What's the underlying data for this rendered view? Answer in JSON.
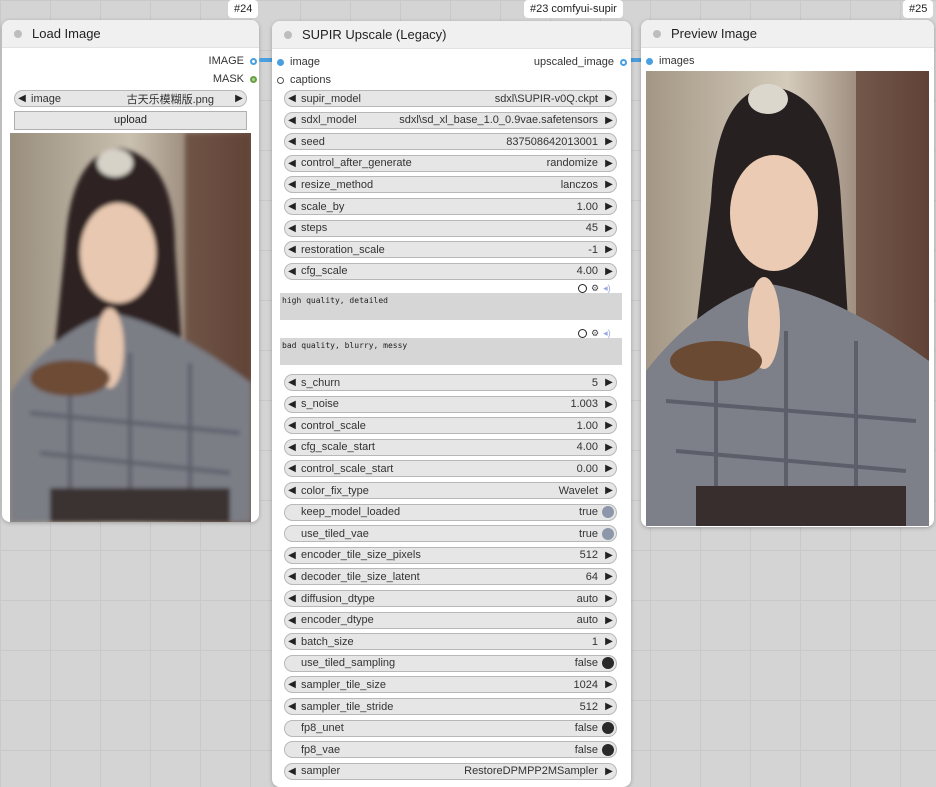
{
  "load_image": {
    "title": "Load Image",
    "badge": "#24",
    "outputs": [
      "IMAGE",
      "MASK"
    ],
    "image_widget_label": "image",
    "image_widget_value": "古天乐模糊版.png",
    "upload_label": "upload"
  },
  "supir": {
    "title": "SUPIR Upscale (Legacy)",
    "badge": "#23 comfyui-supir",
    "inputs": [
      "image",
      "captions"
    ],
    "output": "upscaled_image",
    "positive_prompt": "high quality, detailed",
    "negative_prompt": "bad quality, blurry, messy",
    "widgets": [
      {
        "label": "supir_model",
        "value": "sdxl\\SUPIR-v0Q.ckpt",
        "kind": "combo"
      },
      {
        "label": "sdxl_model",
        "value": "sdxl\\sd_xl_base_1.0_0.9vae.safetensors",
        "kind": "combo"
      },
      {
        "label": "seed",
        "value": "837508642013001",
        "kind": "combo"
      },
      {
        "label": "control_after_generate",
        "value": "randomize",
        "kind": "combo"
      },
      {
        "label": "resize_method",
        "value": "lanczos",
        "kind": "combo"
      },
      {
        "label": "scale_by",
        "value": "1.00",
        "kind": "combo"
      },
      {
        "label": "steps",
        "value": "45",
        "kind": "combo"
      },
      {
        "label": "restoration_scale",
        "value": "-1",
        "kind": "combo"
      },
      {
        "label": "cfg_scale",
        "value": "4.00",
        "kind": "combo"
      }
    ],
    "widgets2": [
      {
        "label": "s_churn",
        "value": "5",
        "kind": "combo"
      },
      {
        "label": "s_noise",
        "value": "1.003",
        "kind": "combo"
      },
      {
        "label": "control_scale",
        "value": "1.00",
        "kind": "combo"
      },
      {
        "label": "cfg_scale_start",
        "value": "4.00",
        "kind": "combo"
      },
      {
        "label": "control_scale_start",
        "value": "0.00",
        "kind": "combo"
      },
      {
        "label": "color_fix_type",
        "value": "Wavelet",
        "kind": "combo"
      },
      {
        "label": "keep_model_loaded",
        "value": "true",
        "kind": "toggle-on"
      },
      {
        "label": "use_tiled_vae",
        "value": "true",
        "kind": "toggle-on"
      },
      {
        "label": "encoder_tile_size_pixels",
        "value": "512",
        "kind": "combo"
      },
      {
        "label": "decoder_tile_size_latent",
        "value": "64",
        "kind": "combo"
      },
      {
        "label": "diffusion_dtype",
        "value": "auto",
        "kind": "combo"
      },
      {
        "label": "encoder_dtype",
        "value": "auto",
        "kind": "combo"
      },
      {
        "label": "batch_size",
        "value": "1",
        "kind": "combo"
      },
      {
        "label": "use_tiled_sampling",
        "value": "false",
        "kind": "toggle-off"
      },
      {
        "label": "sampler_tile_size",
        "value": "1024",
        "kind": "combo"
      },
      {
        "label": "sampler_tile_stride",
        "value": "512",
        "kind": "combo"
      },
      {
        "label": "fp8_unet",
        "value": "false",
        "kind": "toggle-off"
      },
      {
        "label": "fp8_vae",
        "value": "false",
        "kind": "toggle-off"
      },
      {
        "label": "sampler",
        "value": "RestoreDPMPP2MSampler",
        "kind": "combo"
      }
    ]
  },
  "preview": {
    "title": "Preview Image",
    "badge": "#25",
    "input": "images"
  },
  "colors": {
    "image_link": "#4a9fe0",
    "mask_socket": "#7fbf5f"
  }
}
